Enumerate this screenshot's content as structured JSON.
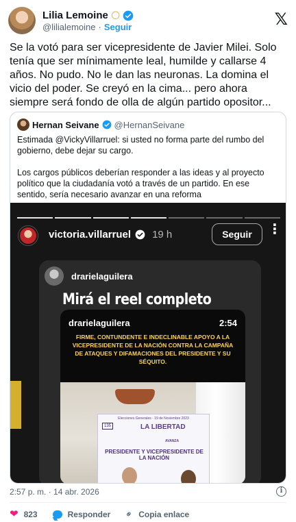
{
  "author": {
    "name": "Lilia Lemoine",
    "emoji": "🌕",
    "handle": "@lilialemoine",
    "separator": "·",
    "follow_label": "Seguir"
  },
  "x_logo": "𝕏",
  "tweet": {
    "text": "Se la votó para ser vicepresidente de Javier Milei. Solo tenía que ser mínimamente leal, humilde y callarse 4 años. No pudo. No le dan las neuronas. La domina el vicio del poder. Se creyó en la cima... pero  ahora siempre será fondo de  olla de algún partido opositor..."
  },
  "quote": {
    "name": "Hernan Seivane",
    "handle": "@HernanSeivane",
    "paragraph1": "Estimada @VickyVillarruel: si usted no forma parte del rumbo del gobierno, debe dejar su cargo.",
    "paragraph2": "Los cargos públicos deberían responder a las ideas y al proyecto político que la ciudadanía votó a través de un partido. En ese sentido, sería necesario avanzar en una reforma"
  },
  "story": {
    "username": "victoria.villarruel",
    "time": "19 h",
    "follow_label": "Seguir",
    "more": "⋮",
    "inner_user": "drarielaguilera",
    "inner_title": "Mirá el reel completo",
    "video_user": "drarielaguilera",
    "video_time": "2:54",
    "banner": "FIRME, CONTUNDENTE E INDECLINABLE APOYO A LA VICEPRESIDENTE DE LA NACIÓN CONTRA LA CAMPAÑA DE ATAQUES Y DIFAMACIONES DEL PRESIDENTE Y SU SÉQUITO.",
    "sign_top": "Elecciones Generales · 19 de Noviembre 2023",
    "sign_badge": "135",
    "sign_brand": "LA LIBERTAD",
    "sign_sub": "AVANZA",
    "sign_role": "PRESIDENTE Y VICEPRESIDENTE DE LA NACIÓN"
  },
  "meta": {
    "timestamp": "2:57 p. m. · 14 abr. 2026"
  },
  "actions": {
    "likes": "823",
    "reply_label": "Responder",
    "copy_label": "Copia enlace"
  },
  "colors": {
    "accent": "#1d9bf0",
    "like": "#f91880",
    "banner_text": "#ffd34d"
  }
}
